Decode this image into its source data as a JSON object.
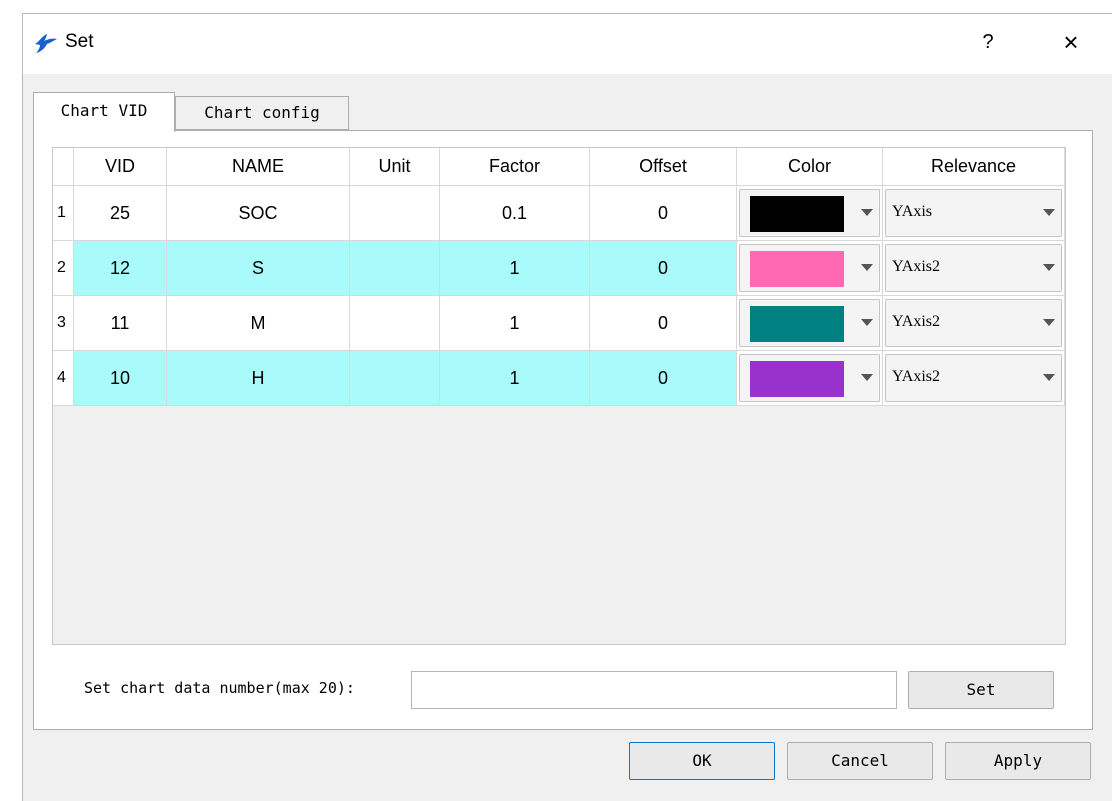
{
  "window": {
    "title": "Set",
    "help_label": "?",
    "close_label": "×"
  },
  "tabs": [
    {
      "label": "Chart VID",
      "active": true
    },
    {
      "label": "Chart config",
      "active": false
    }
  ],
  "table": {
    "columns": [
      "VID",
      "NAME",
      "Unit",
      "Factor",
      "Offset",
      "Color",
      "Relevance"
    ],
    "rows": [
      {
        "index": "1",
        "vid": "25",
        "name": "SOC",
        "unit": "",
        "factor": "0.1",
        "offset": "0",
        "color": "#000000",
        "relevance": "YAxis"
      },
      {
        "index": "2",
        "vid": "12",
        "name": "S",
        "unit": "",
        "factor": "1",
        "offset": "0",
        "color": "#ff69b4",
        "relevance": "YAxis2"
      },
      {
        "index": "3",
        "vid": "11",
        "name": "M",
        "unit": "",
        "factor": "1",
        "offset": "0",
        "color": "#008080",
        "relevance": "YAxis2"
      },
      {
        "index": "4",
        "vid": "10",
        "name": "H",
        "unit": "",
        "factor": "1",
        "offset": "0",
        "color": "#9932cc",
        "relevance": "YAxis2"
      }
    ],
    "alt_row_color": "#a9fbfb"
  },
  "set_row": {
    "label": "Set chart data number(max 20):",
    "input_value": "",
    "button_label": "Set"
  },
  "buttons": {
    "ok": "OK",
    "cancel": "Cancel",
    "apply": "Apply"
  }
}
